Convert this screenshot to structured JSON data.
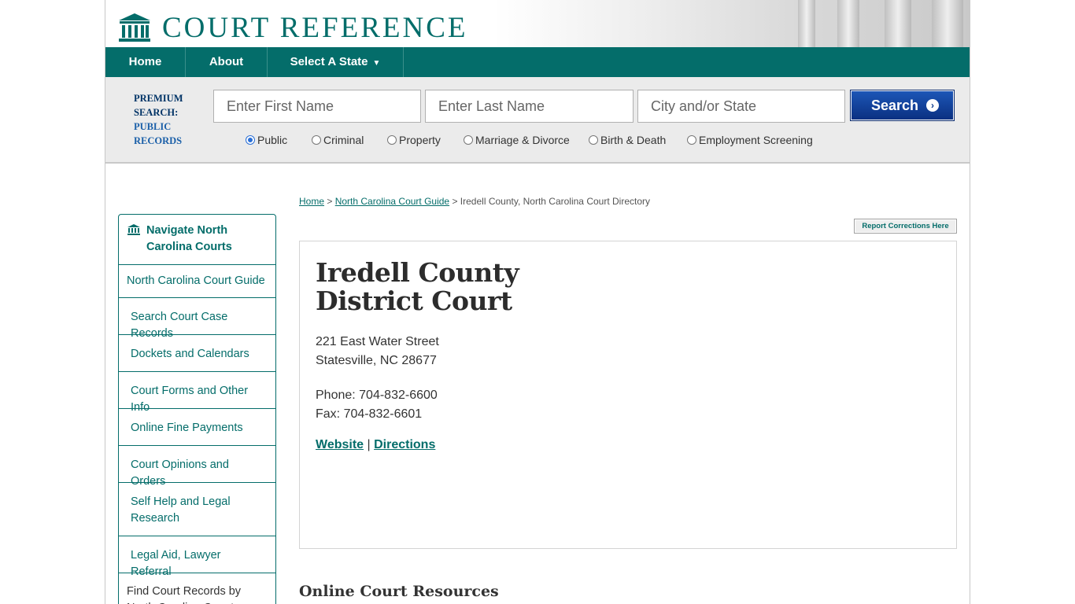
{
  "header": {
    "logo_text": "COURT REFERENCE",
    "nav": [
      {
        "label": "Home"
      },
      {
        "label": "About"
      },
      {
        "label": "Select A State",
        "caret": "▼"
      }
    ]
  },
  "search": {
    "premium_line1": "PREMIUM",
    "premium_line2": "SEARCH:",
    "premium_line3": "PUBLIC",
    "premium_line4": "RECORDS",
    "first_name_placeholder": "Enter First Name",
    "last_name_placeholder": "Enter Last Name",
    "location_placeholder": "City and/or State",
    "button_label": "Search",
    "radio_options": [
      {
        "label": "Public",
        "checked": true
      },
      {
        "label": "Criminal",
        "checked": false
      },
      {
        "label": "Property",
        "checked": false
      },
      {
        "label": "Marriage & Divorce",
        "checked": false
      },
      {
        "label": "Birth & Death",
        "checked": false
      },
      {
        "label": "Employment Screening",
        "checked": false
      }
    ]
  },
  "sidebar": {
    "heading": "Navigate North Carolina Courts",
    "items": [
      {
        "label": "North Carolina Court Guide"
      },
      {
        "label": "Search Court Case Records"
      },
      {
        "label": "Dockets and Calendars"
      },
      {
        "label": "Court Forms and Other Info"
      },
      {
        "label": "Online Fine Payments"
      },
      {
        "label": "Court Opinions and Orders"
      },
      {
        "label": "Self Help and Legal Research"
      },
      {
        "label": "Legal Aid, Lawyer Referral"
      },
      {
        "label": "Find Court Records by North Carolina County"
      }
    ]
  },
  "breadcrumb": {
    "home": "Home",
    "sep1": " > ",
    "guide": "North Carolina Court Guide",
    "sep2": " > ",
    "current": "Iredell County, North Carolina Court Directory"
  },
  "report_button": "Report Corrections Here",
  "court": {
    "title_line1": "Iredell County",
    "title_line2": "District Court",
    "address_line1": "221 East Water Street",
    "address_line2": "Statesville, NC 28677",
    "phone": "Phone: 704-832-6600",
    "fax": "Fax: 704-832-6601",
    "website_label": "Website",
    "link_separator": " | ",
    "directions_label": "Directions"
  },
  "section_title": "Online Court Resources",
  "colors": {
    "brand_teal": "#046d6a",
    "search_button": "#0a2f80"
  }
}
